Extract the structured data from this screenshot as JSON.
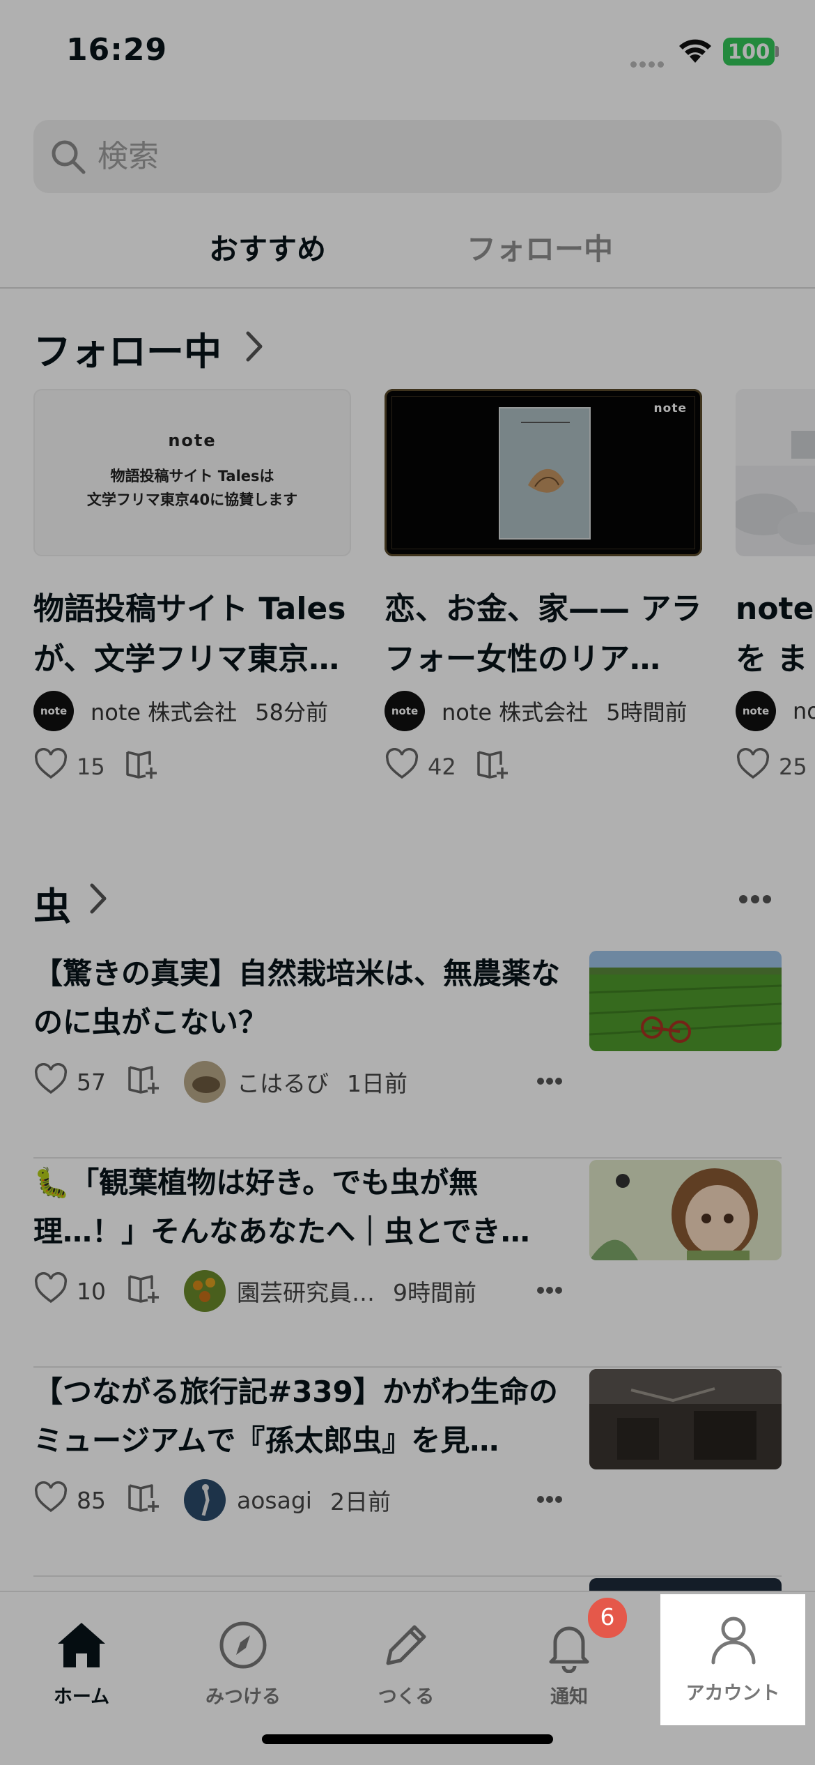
{
  "status": {
    "time": "16:29",
    "battery": "100"
  },
  "search": {
    "placeholder": "検索"
  },
  "tabs": {
    "recommended": "おすすめ",
    "following": "フォロー中"
  },
  "following_section": {
    "title": "フォロー中",
    "cards": [
      {
        "thumb_brand": "note",
        "thumb_line1": "物語投稿サイト Talesは",
        "thumb_line2": "文学フリマ東京40に協賛します",
        "title": "物語投稿サイト Tales が、文学フリマ東京…",
        "author": "note 株式会社",
        "time": "58分前",
        "likes": "15"
      },
      {
        "thumb_brand": "note",
        "title": "恋、お金、家—— アラフォー女性のリア…",
        "author": "note 株式会社",
        "time": "5時間前",
        "likes": "42"
      },
      {
        "title": "note を まとめ",
        "author": "no",
        "time": "",
        "likes": "25"
      }
    ]
  },
  "insect_section": {
    "title": "虫",
    "items": [
      {
        "title": "【驚きの真実】自然栽培米は、無農薬なのに虫がこない？",
        "likes": "57",
        "user": "こはるび",
        "time": "1日前"
      },
      {
        "title": "🐛「観葉植物は好き。でも虫が無理…！」そんなあなたへ｜虫とでき…",
        "likes": "10",
        "user": "園芸研究員…",
        "time": "9時間前"
      },
      {
        "title": "【つながる旅行記#339】かがわ生命のミュージアムで『孫太郎虫』を見…",
        "likes": "85",
        "user": "aosagi",
        "time": "2日前"
      }
    ]
  },
  "tabbar": {
    "home": "ホーム",
    "discover": "みつける",
    "create": "つくる",
    "notifications": "通知",
    "notification_count": "6",
    "account": "アカウント"
  },
  "colors": {
    "badge": "#e5584a",
    "battery": "#34c759",
    "overlay": "rgba(0,0,0,0.31)"
  }
}
